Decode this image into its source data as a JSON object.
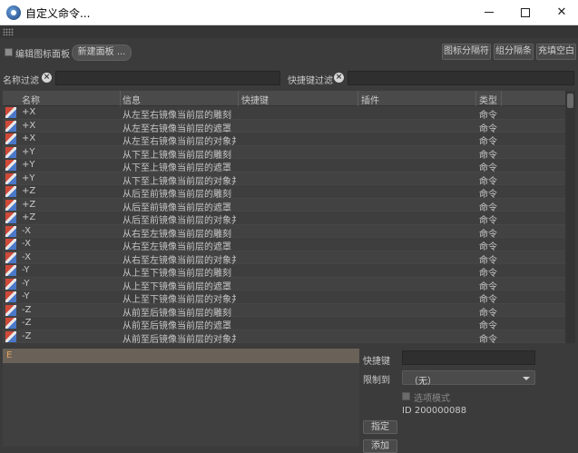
{
  "window": {
    "title": "自定义命令..."
  },
  "toolbar": {
    "edit_panel_label": "编辑图标面板",
    "new_panel_label": "新建面板 ...",
    "icon_separator_label": "图标分隔符",
    "group_separator_label": "组分隔条",
    "fill_space_label": "充填空白"
  },
  "filters": {
    "name_filter_label": "名称过滤",
    "shortcut_filter_label": "快捷键过滤"
  },
  "table": {
    "columns": [
      "名称",
      "信息",
      "快捷键",
      "插件",
      "类型"
    ],
    "rows": [
      {
        "name": "+X",
        "info": "从左至右镜像当前层的雕刻",
        "shortcut": "",
        "plugin": "",
        "type": "命令"
      },
      {
        "name": "+X",
        "info": "从左至右镜像当前层的遮罩",
        "shortcut": "",
        "plugin": "",
        "type": "命令"
      },
      {
        "name": "+X",
        "info": "从左至右镜像当前层的对象并忍",
        "shortcut": "",
        "plugin": "",
        "type": "命令"
      },
      {
        "name": "+Y",
        "info": "从下至上镜像当前层的雕刻",
        "shortcut": "",
        "plugin": "",
        "type": "命令"
      },
      {
        "name": "+Y",
        "info": "从下至上镜像当前层的遮罩",
        "shortcut": "",
        "plugin": "",
        "type": "命令"
      },
      {
        "name": "+Y",
        "info": "从下至上镜像当前层的对象并忍",
        "shortcut": "",
        "plugin": "",
        "type": "命令"
      },
      {
        "name": "+Z",
        "info": "从后至前镜像当前层的雕刻",
        "shortcut": "",
        "plugin": "",
        "type": "命令"
      },
      {
        "name": "+Z",
        "info": "从后至前镜像当前层的遮罩",
        "shortcut": "",
        "plugin": "",
        "type": "命令"
      },
      {
        "name": "+Z",
        "info": "从后至前镜像当前层的对象并忍",
        "shortcut": "",
        "plugin": "",
        "type": "命令"
      },
      {
        "name": "-X",
        "info": "从右至左镜像当前层的雕刻",
        "shortcut": "",
        "plugin": "",
        "type": "命令"
      },
      {
        "name": "-X",
        "info": "从右至左镜像当前层的遮罩",
        "shortcut": "",
        "plugin": "",
        "type": "命令"
      },
      {
        "name": "-X",
        "info": "从右至左镜像当前层的对象并忍",
        "shortcut": "",
        "plugin": "",
        "type": "命令"
      },
      {
        "name": "-Y",
        "info": "从上至下镜像当前层的雕刻",
        "shortcut": "",
        "plugin": "",
        "type": "命令"
      },
      {
        "name": "-Y",
        "info": "从上至下镜像当前层的遮罩",
        "shortcut": "",
        "plugin": "",
        "type": "命令"
      },
      {
        "name": "-Y",
        "info": "从上至下镜像当前层的对象并忍",
        "shortcut": "",
        "plugin": "",
        "type": "命令"
      },
      {
        "name": "-Z",
        "info": "从前至后镜像当前层的雕刻",
        "shortcut": "",
        "plugin": "",
        "type": "命令"
      },
      {
        "name": "-Z",
        "info": "从前至后镜像当前层的遮罩",
        "shortcut": "",
        "plugin": "",
        "type": "命令"
      },
      {
        "name": "-Z",
        "info": "从前至后镜像当前层的对象并忍",
        "shortcut": "",
        "plugin": "",
        "type": "命令"
      }
    ]
  },
  "selection": {
    "marker": "E"
  },
  "properties": {
    "shortcut_label": "快捷键",
    "restrict_label": "限制到",
    "restrict_value": "（无）",
    "option_mode_label": "选项模式",
    "id_text": "ID 200000088",
    "assign_label": "指定",
    "add_label": "添加"
  }
}
